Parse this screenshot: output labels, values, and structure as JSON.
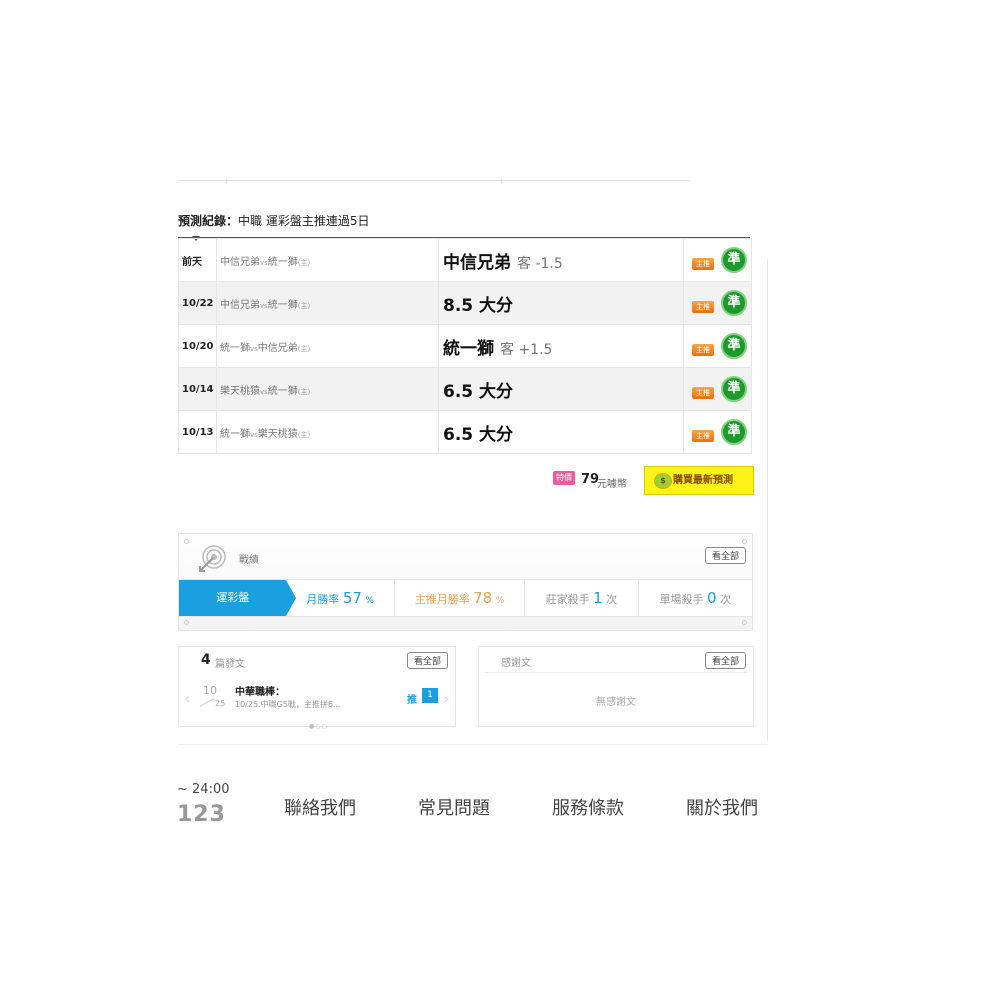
{
  "record": {
    "title_bold": "預測紀錄：",
    "title_text": "中職 運彩盤主推連過5日",
    "rows": [
      {
        "date": "前天",
        "match": "中信兄弟",
        "vs": "vs",
        "opp": "統一獅",
        "home": "(主)",
        "pick": "中信兄弟",
        "odds": "客 -1.5",
        "tag": "主推",
        "result": "準"
      },
      {
        "date": "10/22",
        "match": "中信兄弟",
        "vs": "vs",
        "opp": "統一獅",
        "home": "(主)",
        "pick": "8.5 大分",
        "odds": "",
        "tag": "主推",
        "result": "準"
      },
      {
        "date": "10/20",
        "match": "統一獅",
        "vs": "vs",
        "opp": "中信兄弟",
        "home": "(主)",
        "pick": "統一獅",
        "odds": "客 +1.5",
        "tag": "主推",
        "result": "準"
      },
      {
        "date": "10/14",
        "match": "樂天桃猿",
        "vs": "vs",
        "opp": "統一獅",
        "home": "(主)",
        "pick": "6.5 大分",
        "odds": "",
        "tag": "主推",
        "result": "準"
      },
      {
        "date": "10/13",
        "match": "統一獅",
        "vs": "vs",
        "opp": "樂天桃猿",
        "home": "(主)",
        "pick": "6.5 大分",
        "odds": "",
        "tag": "主推",
        "result": "準"
      }
    ]
  },
  "purchase": {
    "badge": "特價",
    "price": "79",
    "unit": "元噱幣",
    "button": "購買最新預測",
    "colors": {
      "button_bg": "#fff31a",
      "badge_bg": "#ef5a9a"
    }
  },
  "stats": {
    "label": "戰績",
    "view_all": "看全部",
    "tab": "運彩盤",
    "monthly_win_label": "月勝率",
    "monthly_win": "57",
    "main_win_label": "主推月勝率",
    "main_win": "78",
    "pct": "%",
    "killer_label": "莊家殺手",
    "killer": "1",
    "single_label": "單場殺手",
    "single": "0",
    "times": "次",
    "accent": "#1a9fe0"
  },
  "articles": {
    "count": "4",
    "label": "篇發文",
    "view_all": "看全部",
    "item": {
      "month": "10",
      "day": "25",
      "title": "中華職棒：",
      "sub": "10/25.中職G5戰，主推拼6...",
      "rec_label": "推",
      "rec_count": "1"
    }
  },
  "thanks": {
    "label": "感謝文",
    "view_all": "看全部",
    "empty": "無感謝文"
  },
  "footer": {
    "hours": "~ 24:00",
    "number": "123",
    "links": [
      "聯絡我們",
      "常見問題",
      "服務條款",
      "關於我們"
    ]
  }
}
